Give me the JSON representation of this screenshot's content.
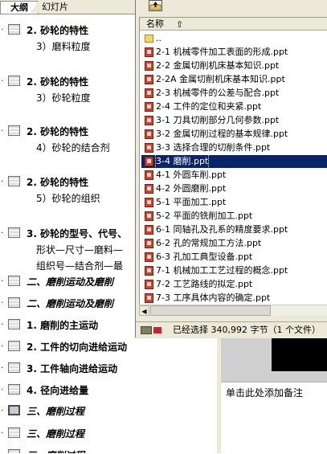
{
  "outline": {
    "tabs": [
      "大纲",
      "幻灯片"
    ],
    "slides": [
      {
        "title": "2. 砂轮的特性",
        "sub": [
          "3）磨料粒度"
        ],
        "italic": false
      },
      {
        "title": "2. 砂轮的特性",
        "sub": [
          "3）砂轮粒度"
        ],
        "italic": false
      },
      {
        "title": "2. 砂轮的特性",
        "sub": [
          "4）砂轮的结合剂"
        ],
        "italic": false
      },
      {
        "title": "2. 砂轮的特性",
        "sub": [
          "5）砂轮的组织"
        ],
        "italic": false
      },
      {
        "title": "3. 砂轮的型号、代号、",
        "sub": [
          "形状—尺寸—磨料—",
          "组织号—结合剂—最"
        ],
        "italic": false
      },
      {
        "title": "二、磨削运动及磨削",
        "sub": [],
        "italic": true
      },
      {
        "title": "二、磨削运动及磨削",
        "sub": [],
        "italic": true
      },
      {
        "title": "1. 磨削的主运动",
        "sub": [],
        "italic": false
      },
      {
        "title": "2. 工件的切向进给运动",
        "sub": [],
        "italic": false
      },
      {
        "title": "3. 工件轴向进给运动",
        "sub": [],
        "italic": false
      },
      {
        "title": "4. 径向进给量",
        "sub": [],
        "italic": false
      },
      {
        "title": "三、磨削过程",
        "sub": [],
        "italic": true,
        "selected": true
      },
      {
        "title": "三、磨削过程",
        "sub": [],
        "italic": true
      },
      {
        "title": "三、磨削过程",
        "sub": [],
        "italic": true
      }
    ]
  },
  "notes": {
    "placeholder": "单击此处添加备注"
  },
  "dialog": {
    "column_name": "名称",
    "files": [
      {
        "name": "..",
        "type": "folder"
      },
      {
        "name": "2-1 机械零件加工表面的形成.ppt",
        "type": "ppt"
      },
      {
        "name": "2-2 金属切削机床基本知识.ppt",
        "type": "ppt"
      },
      {
        "name": "2-2A 金属切削机床基本知识.ppt",
        "type": "ppt"
      },
      {
        "name": "2-3 机械零件的公差与配合.ppt",
        "type": "ppt"
      },
      {
        "name": "2-4 工件的定位和夹紧.ppt",
        "type": "ppt"
      },
      {
        "name": "3-1 刀具切削部分几何参数.ppt",
        "type": "ppt"
      },
      {
        "name": "3-2 金属切削过程的基本规律.ppt",
        "type": "ppt"
      },
      {
        "name": "3-3 选择合理的切削条件.ppt",
        "type": "ppt"
      },
      {
        "name": "3-4 磨削.ppt",
        "type": "ppt",
        "selected": true
      },
      {
        "name": "4-1 外圆车削.ppt",
        "type": "ppt"
      },
      {
        "name": "4-2 外圆磨削.ppt",
        "type": "ppt"
      },
      {
        "name": "5-1 平面加工.ppt",
        "type": "ppt"
      },
      {
        "name": "5-2 平面的铣削加工.ppt",
        "type": "ppt"
      },
      {
        "name": "6-1 同轴孔及孔系的精度要求.ppt",
        "type": "ppt"
      },
      {
        "name": "6-2 孔的常规加工方法.ppt",
        "type": "ppt"
      },
      {
        "name": "6-3 孔加工典型设备.ppt",
        "type": "ppt"
      },
      {
        "name": "7-1 机械加工工艺过程的概念.ppt",
        "type": "ppt"
      },
      {
        "name": "7-2 工艺路线的拟定.ppt",
        "type": "ppt"
      },
      {
        "name": "7-3 工序具体内容的确定.ppt",
        "type": "ppt"
      }
    ],
    "status": "已经选择 340,992 字节（1 个文件）"
  }
}
